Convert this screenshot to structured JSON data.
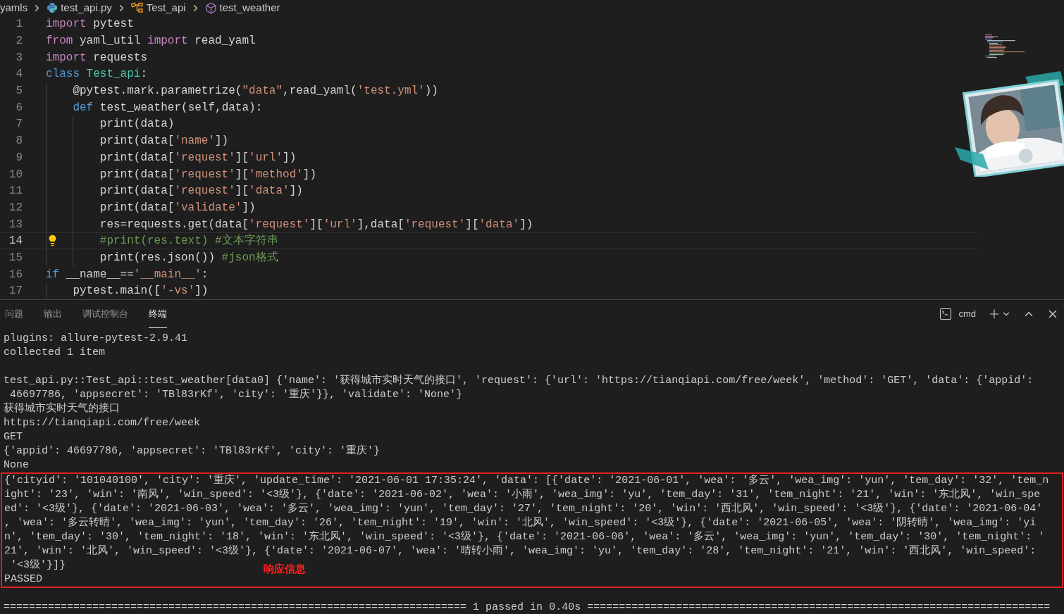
{
  "breadcrumb": [
    {
      "kind": "folder",
      "label": "yamls"
    },
    {
      "kind": "python-file",
      "label": "test_api.py"
    },
    {
      "kind": "class",
      "label": "Test_api"
    },
    {
      "kind": "method",
      "label": "test_weather"
    }
  ],
  "editor": {
    "lines": [
      {
        "number": "1",
        "current": false,
        "tokens": [
          {
            "kind": "keyword",
            "text": "import"
          },
          {
            "kind": "plain",
            "text": " pytest"
          }
        ]
      },
      {
        "number": "2",
        "current": false,
        "tokens": [
          {
            "kind": "keyword",
            "text": "from"
          },
          {
            "kind": "plain",
            "text": " yaml_util "
          },
          {
            "kind": "keyword",
            "text": "import"
          },
          {
            "kind": "plain",
            "text": " read_yaml"
          }
        ]
      },
      {
        "number": "3",
        "current": false,
        "tokens": [
          {
            "kind": "keyword",
            "text": "import"
          },
          {
            "kind": "plain",
            "text": " requests"
          }
        ]
      },
      {
        "number": "4",
        "current": false,
        "tokens": [
          {
            "kind": "storage",
            "text": "class "
          },
          {
            "kind": "type",
            "text": "Test_api"
          },
          {
            "kind": "plain",
            "text": ":"
          }
        ]
      },
      {
        "number": "5",
        "current": false,
        "tokens": [
          {
            "kind": "plain",
            "text": "    @pytest.mark.parametrize("
          },
          {
            "kind": "string",
            "text": "\"data\""
          },
          {
            "kind": "plain",
            "text": ",read_yaml("
          },
          {
            "kind": "string",
            "text": "'test.yml'"
          },
          {
            "kind": "plain",
            "text": "))"
          }
        ]
      },
      {
        "number": "6",
        "current": false,
        "tokens": [
          {
            "kind": "storage",
            "text": "    def"
          },
          {
            "kind": "plain",
            "text": " test_weather(self,data):"
          }
        ]
      },
      {
        "number": "7",
        "current": false,
        "tokens": [
          {
            "kind": "plain",
            "text": "        print(data)"
          }
        ]
      },
      {
        "number": "8",
        "current": false,
        "tokens": [
          {
            "kind": "plain",
            "text": "        print(data["
          },
          {
            "kind": "string",
            "text": "'name'"
          },
          {
            "kind": "plain",
            "text": "])"
          }
        ]
      },
      {
        "number": "9",
        "current": false,
        "tokens": [
          {
            "kind": "plain",
            "text": "        print(data["
          },
          {
            "kind": "string",
            "text": "'request'"
          },
          {
            "kind": "plain",
            "text": "]["
          },
          {
            "kind": "string",
            "text": "'url'"
          },
          {
            "kind": "plain",
            "text": "])"
          }
        ]
      },
      {
        "number": "10",
        "current": false,
        "tokens": [
          {
            "kind": "plain",
            "text": "        print(data["
          },
          {
            "kind": "string",
            "text": "'request'"
          },
          {
            "kind": "plain",
            "text": "]["
          },
          {
            "kind": "string",
            "text": "'method'"
          },
          {
            "kind": "plain",
            "text": "])"
          }
        ]
      },
      {
        "number": "11",
        "current": false,
        "tokens": [
          {
            "kind": "plain",
            "text": "        print(data["
          },
          {
            "kind": "string",
            "text": "'request'"
          },
          {
            "kind": "plain",
            "text": "]["
          },
          {
            "kind": "string",
            "text": "'data'"
          },
          {
            "kind": "plain",
            "text": "])"
          }
        ]
      },
      {
        "number": "12",
        "current": false,
        "tokens": [
          {
            "kind": "plain",
            "text": "        print(data["
          },
          {
            "kind": "string",
            "text": "'validate'"
          },
          {
            "kind": "plain",
            "text": "])"
          }
        ]
      },
      {
        "number": "13",
        "current": false,
        "tokens": [
          {
            "kind": "plain",
            "text": "        res=requests.get(data["
          },
          {
            "kind": "string",
            "text": "'request'"
          },
          {
            "kind": "plain",
            "text": "]["
          },
          {
            "kind": "string",
            "text": "'url'"
          },
          {
            "kind": "plain",
            "text": "],data["
          },
          {
            "kind": "string",
            "text": "'request'"
          },
          {
            "kind": "plain",
            "text": "]["
          },
          {
            "kind": "string",
            "text": "'data'"
          },
          {
            "kind": "plain",
            "text": "])"
          }
        ]
      },
      {
        "number": "14",
        "current": true,
        "tokens": [
          {
            "kind": "comment",
            "text": "        #print(res.text) #文本字符串"
          }
        ]
      },
      {
        "number": "15",
        "current": false,
        "tokens": [
          {
            "kind": "plain",
            "text": "        print(res.json()) "
          },
          {
            "kind": "comment",
            "text": "#json格式"
          }
        ]
      },
      {
        "number": "16",
        "current": false,
        "tokens": [
          {
            "kind": "storage",
            "text": "if"
          },
          {
            "kind": "plain",
            "text": " __name__=="
          },
          {
            "kind": "string",
            "text": "'__main__'"
          },
          {
            "kind": "plain",
            "text": ":"
          }
        ]
      },
      {
        "number": "17",
        "current": false,
        "tokens": [
          {
            "kind": "plain",
            "text": "    pytest.main(["
          },
          {
            "kind": "string",
            "text": "'-vs'"
          },
          {
            "kind": "plain",
            "text": "])"
          }
        ]
      }
    ]
  },
  "panel": {
    "tabs": [
      {
        "label": "问题",
        "selected": false
      },
      {
        "label": "输出",
        "selected": false
      },
      {
        "label": "调试控制台",
        "selected": false
      },
      {
        "label": "终端",
        "selected": true
      }
    ],
    "shell": "cmd"
  },
  "terminal": {
    "lines": [
      "plugins: allure-pytest-2.9.41",
      "collected 1 item",
      "test_api.py::Test_api::test_weather[data0] {'name': '获得城市实时天气的接口', 'request': {'url': 'https://tianqiapi.com/free/week', 'method': 'GET', 'data': {'appid':",
      " 46697786, 'appsecret': 'TBl83rKf', 'city': '重庆'}}, 'validate': 'None'}",
      "获得城市实时天气的接口",
      "https://tianqiapi.com/free/week",
      "GET",
      "{'appid': 46697786, 'appsecret': 'TBl83rKf', 'city': '重庆'}",
      "None"
    ],
    "response_box": {
      "lines": [
        "{'cityid': '101040100', 'city': '重庆', 'update_time': '2021-06-01 17:35:24', 'data': [{'date': '2021-06-01', 'wea': '多云', 'wea_img': 'yun', 'tem_day': '32', 'tem_n",
        "ight': '23', 'win': '南风', 'win_speed': '<3级'}, {'date': '2021-06-02', 'wea': '小雨', 'wea_img': 'yu', 'tem_day': '31', 'tem_night': '21', 'win': '东北风', 'win_spe",
        "ed': '<3级'}, {'date': '2021-06-03', 'wea': '多云', 'wea_img': 'yun', 'tem_day': '27', 'tem_night': '20', 'win': '西北风', 'win_speed': '<3级'}, {'date': '2021-06-04'",
        ", 'wea': '多云转晴', 'wea_img': 'yun', 'tem_day': '26', 'tem_night': '19', 'win': '北风', 'win_speed': '<3级'}, {'date': '2021-06-05', 'wea': '阴转晴', 'wea_img': 'yi",
        "n', 'tem_day': '30', 'tem_night': '18', 'win': '东北风', 'win_speed': '<3级'}, {'date': '2021-06-06', 'wea': '多云', 'wea_img': 'yun', 'tem_day': '30', 'tem_night': '",
        "21', 'win': '北风', 'win_speed': '<3级'}, {'date': '2021-06-07', 'wea': '晴转小雨', 'wea_img': 'yu', 'tem_day': '28', 'tem_night': '21', 'win': '西北风', 'win_speed':",
        " '<3级'}]}",
        "PASSED"
      ],
      "annotation": "响应信息"
    },
    "summary": "========================================================================= 1 passed in 0.40s ========================================================================="
  }
}
